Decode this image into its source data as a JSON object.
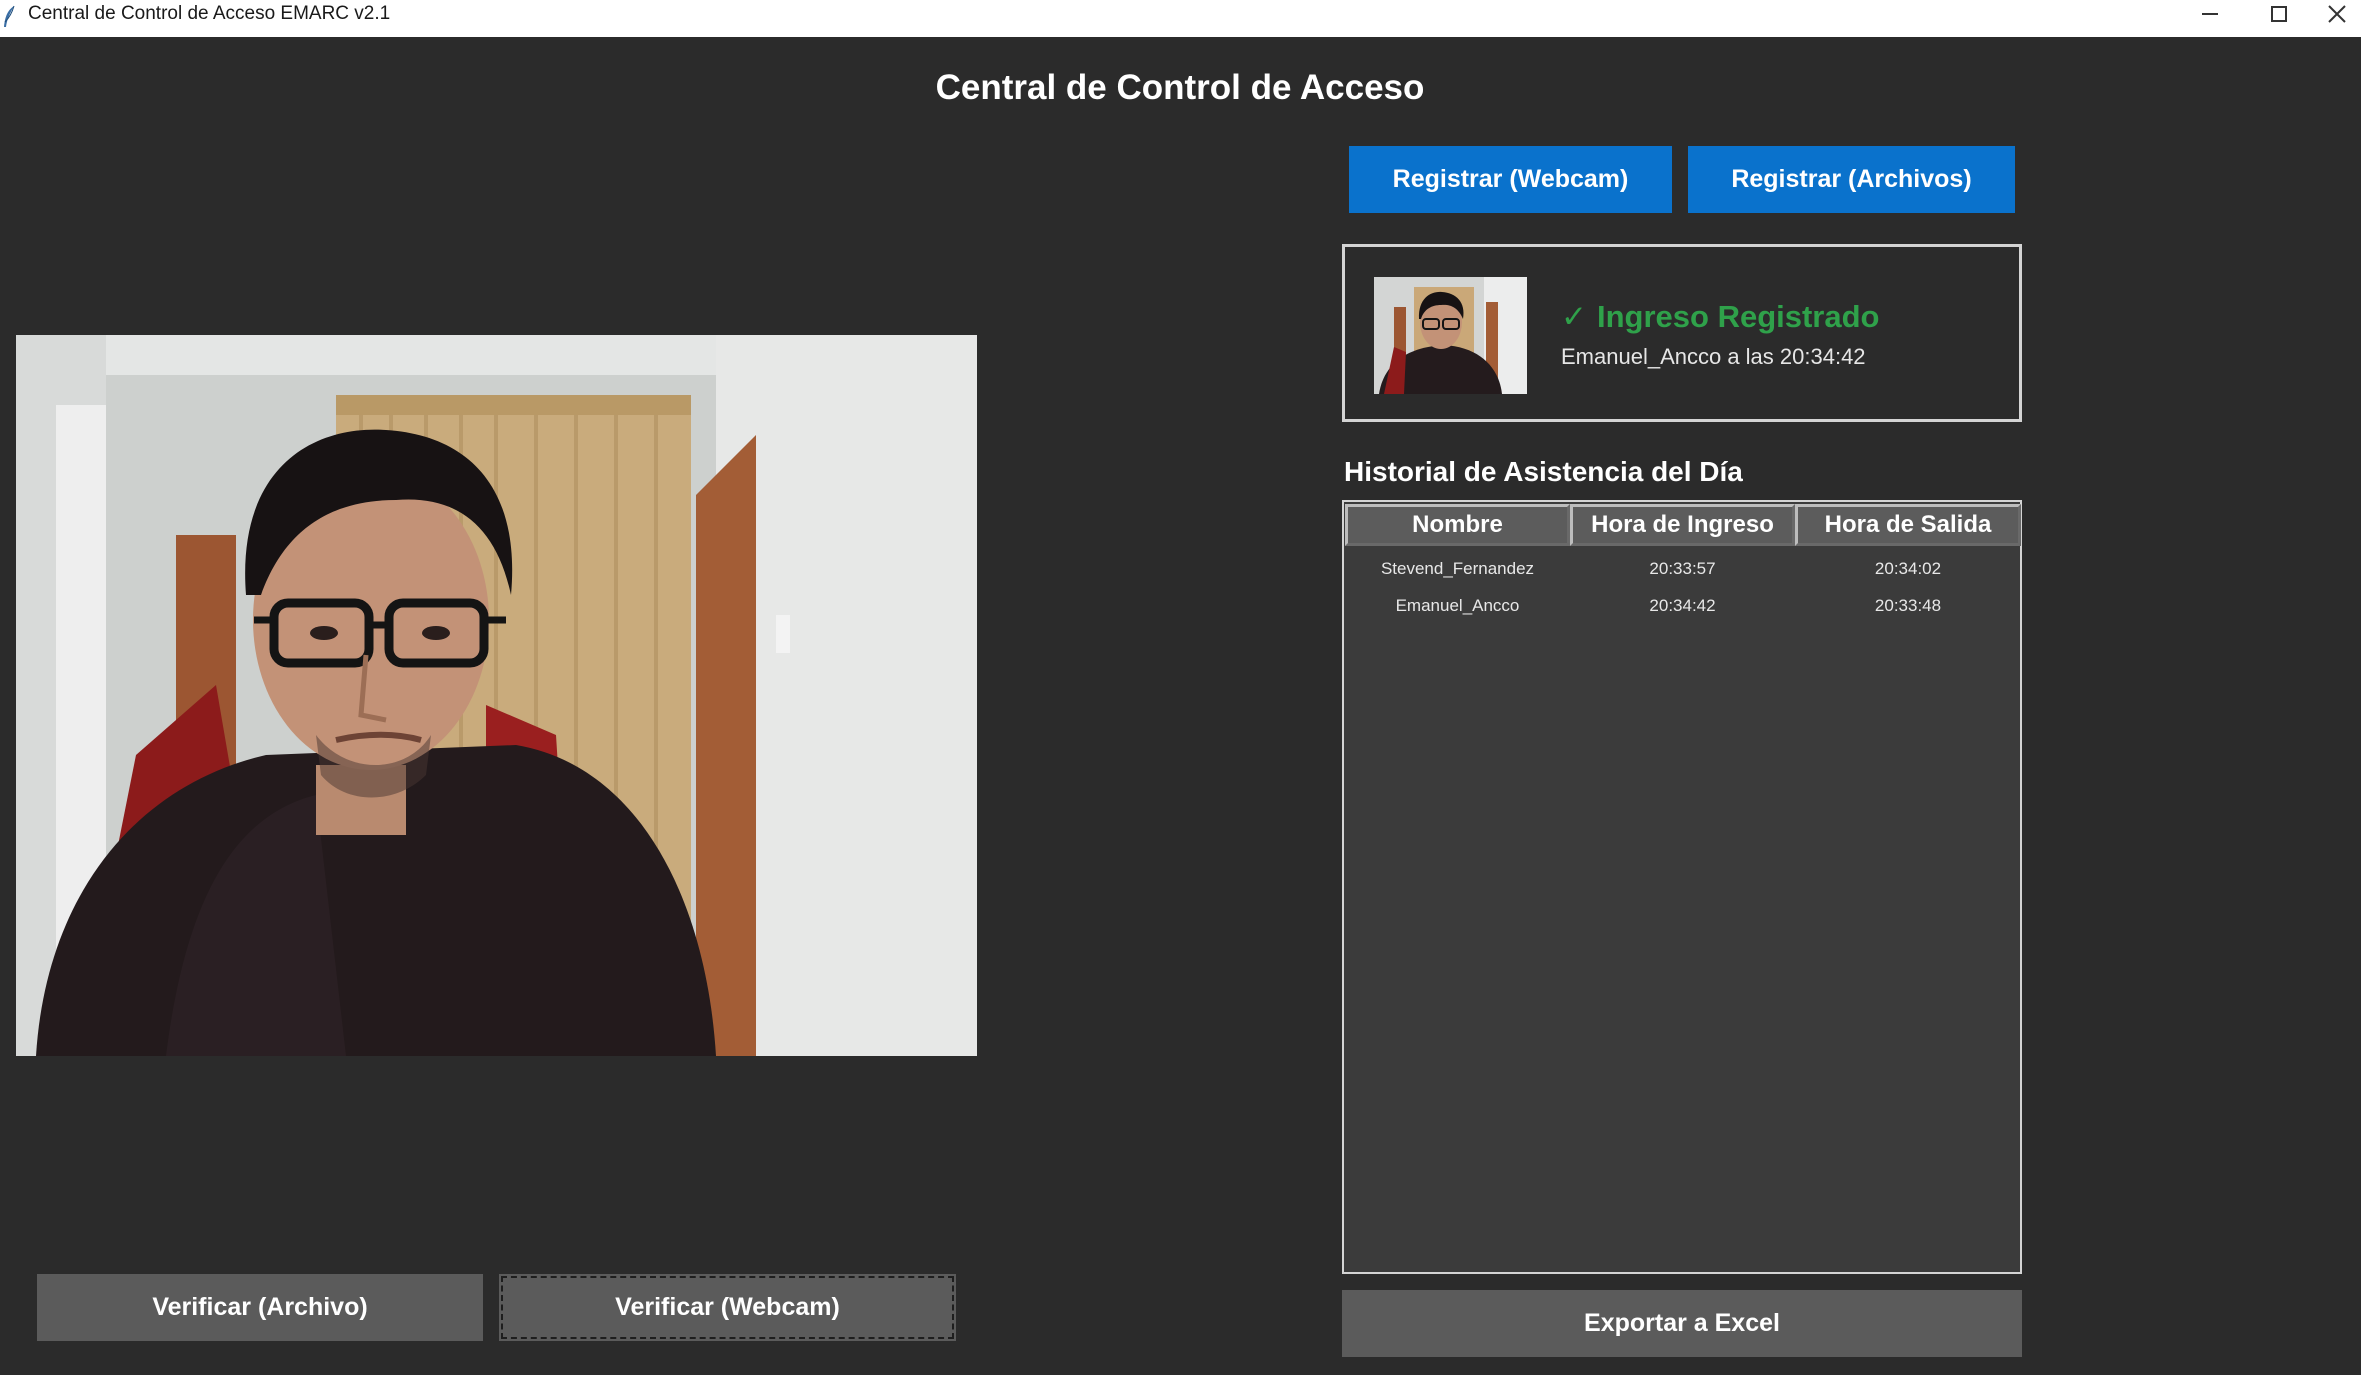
{
  "window": {
    "title": "Central de Control de Acceso EMARC v2.1"
  },
  "page": {
    "title": "Central de Control de Acceso"
  },
  "actions": {
    "verify_file": "Verificar (Archivo)",
    "verify_webcam": "Verificar (Webcam)",
    "register_webcam": "Registrar (Webcam)",
    "register_files": "Registrar (Archivos)",
    "export_excel": "Exportar a Excel"
  },
  "status": {
    "icon": "check-icon",
    "headline": "Ingreso Registrado",
    "detail": "Emanuel_Ancco a las 20:34:42",
    "color": "#2fa14a"
  },
  "history": {
    "title": "Historial de Asistencia del Día",
    "columns": [
      "Nombre",
      "Hora de Ingreso",
      "Hora de Salida"
    ],
    "rows": [
      [
        "Stevend_Fernandez",
        "20:33:57",
        "20:34:02"
      ],
      [
        "Emanuel_Ancco",
        "20:34:42",
        "20:33:48"
      ]
    ]
  },
  "colors": {
    "background": "#2b2b2b",
    "button_blue": "#0a72cc",
    "button_grey": "#5b5b5b",
    "success": "#2fa14a"
  }
}
